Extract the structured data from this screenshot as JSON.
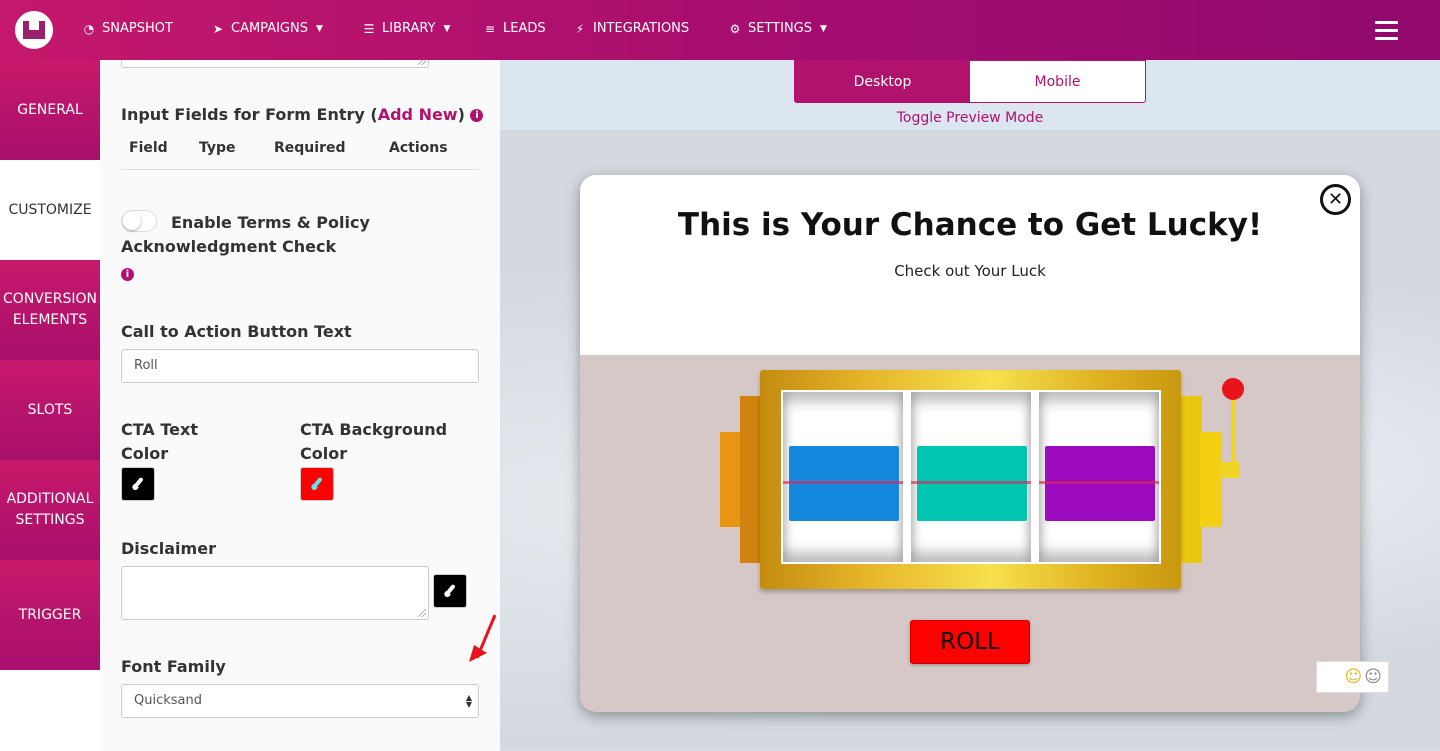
{
  "nav": {
    "items": [
      {
        "label": "SNAPSHOT",
        "icon": "dashboard-icon",
        "has_dropdown": false
      },
      {
        "label": "CAMPAIGNS",
        "icon": "paper-plane-icon",
        "has_dropdown": true
      },
      {
        "label": "LIBRARY",
        "icon": "server-icon",
        "has_dropdown": true
      },
      {
        "label": "LEADS",
        "icon": "list-icon",
        "has_dropdown": false
      },
      {
        "label": "INTEGRATIONS",
        "icon": "plug-icon",
        "has_dropdown": false
      },
      {
        "label": "SETTINGS",
        "icon": "cogs-icon",
        "has_dropdown": true
      }
    ]
  },
  "side_tabs": [
    {
      "label": "GENERAL",
      "active": false
    },
    {
      "label": "CUSTOMIZE",
      "active": true
    },
    {
      "label": "CONVERSION ELEMENTS",
      "active": false
    },
    {
      "label": "SLOTS",
      "active": false
    },
    {
      "label": "ADDITIONAL SETTINGS",
      "active": false
    },
    {
      "label": "TRIGGER",
      "active": false
    }
  ],
  "panel": {
    "input_fields": {
      "title": "Input Fields for Form Entry (",
      "add_new": "Add New",
      "title_end": ")",
      "columns": [
        "Field",
        "Type",
        "Required",
        "Actions"
      ]
    },
    "terms": {
      "label": "Enable Terms & Policy Acknowledgment Check",
      "enabled": false
    },
    "cta_text": {
      "label": "Call to Action Button Text",
      "value": "Roll"
    },
    "cta_text_color": {
      "label": "CTA Text Color",
      "color": "#000000"
    },
    "cta_bg_color": {
      "label": "CTA Background Color",
      "color": "#ff0000"
    },
    "disclaimer": {
      "label": "Disclaimer",
      "value": "",
      "color": "#000000"
    },
    "font_family": {
      "label": "Font Family",
      "value": "Quicksand"
    }
  },
  "preview": {
    "modes": [
      "Desktop",
      "Mobile"
    ],
    "active_mode": "Desktop",
    "toggle_caption": "Toggle Preview Mode",
    "popup": {
      "title": "This is Your Chance to Get Lucky!",
      "subtitle": "Check out Your Luck",
      "reel_colors": [
        "#1388dd",
        "#00c5b0",
        "#9b0bbd"
      ],
      "button_label": "ROLL"
    }
  },
  "colors": {
    "brand": "#b0126e",
    "nav_gradient_start": "#c4186c",
    "nav_gradient_end": "#910a6e"
  }
}
